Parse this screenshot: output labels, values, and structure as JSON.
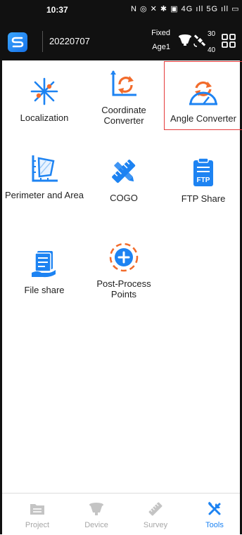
{
  "status": {
    "time": "10:37",
    "icons": "N ◎ ✕ ✱ ▣ 4G ıll 5G ıll ▭"
  },
  "header": {
    "project": "20220707",
    "solution": "Fixed",
    "age": "Age1",
    "sat_visible": "30",
    "sat_used": "40"
  },
  "tools": [
    {
      "label": "Localization",
      "icon": "localization-icon"
    },
    {
      "label": "Coordinate Converter",
      "icon": "coordinate-converter-icon"
    },
    {
      "label": "Angle Converter",
      "icon": "angle-converter-icon",
      "selected": true
    },
    {
      "label": "Perimeter and Area",
      "icon": "perimeter-area-icon"
    },
    {
      "label": "COGO",
      "icon": "cogo-icon"
    },
    {
      "label": "FTP Share",
      "icon": "ftp-share-icon"
    },
    {
      "label": "File share",
      "icon": "file-share-icon"
    },
    {
      "label": "Post-Process Points",
      "icon": "post-process-points-icon"
    }
  ],
  "ftp_badge": "FTP",
  "nav": [
    {
      "label": "Project"
    },
    {
      "label": "Device"
    },
    {
      "label": "Survey"
    },
    {
      "label": "Tools",
      "active": true
    }
  ],
  "colors": {
    "accent": "#1d83f2",
    "highlight": "#e53b3b",
    "orange": "#f26b2b"
  }
}
